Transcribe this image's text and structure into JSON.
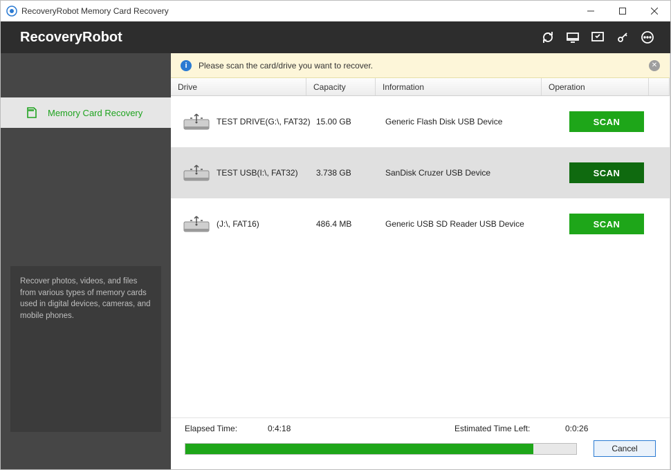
{
  "window": {
    "title": "RecoveryRobot Memory Card Recovery"
  },
  "header": {
    "brand": "RecoveryRobot"
  },
  "sidebar": {
    "item_label": "Memory Card Recovery",
    "description": "Recover photos, videos, and files from various types of memory cards used in digital devices, cameras, and mobile phones."
  },
  "notice": {
    "text": "Please scan the card/drive you want to recover."
  },
  "columns": {
    "drive": "Drive",
    "capacity": "Capacity",
    "information": "Information",
    "operation": "Operation"
  },
  "drives": [
    {
      "name": "TEST DRIVE(G:\\, FAT32)",
      "capacity": "15.00 GB",
      "info": "Generic  Flash Disk  USB Device",
      "button": "SCAN",
      "selected": false
    },
    {
      "name": "TEST USB(I:\\, FAT32)",
      "capacity": "3.738 GB",
      "info": "SanDisk  Cruzer  USB Device",
      "button": "SCAN",
      "selected": true
    },
    {
      "name": "(J:\\, FAT16)",
      "capacity": "486.4 MB",
      "info": "Generic  USB SD Reader  USB Device",
      "button": "SCAN",
      "selected": false
    }
  ],
  "footer": {
    "elapsed_label": "Elapsed Time:",
    "elapsed_value": "0:4:18",
    "remaining_label": "Estimated Time Left:",
    "remaining_value": "0:0:26",
    "cancel": "Cancel",
    "progress_percent": 89
  },
  "colors": {
    "accent_green": "#1ea619",
    "header_dark": "#2d2d2d",
    "notice_bg": "#fdf6d9"
  }
}
